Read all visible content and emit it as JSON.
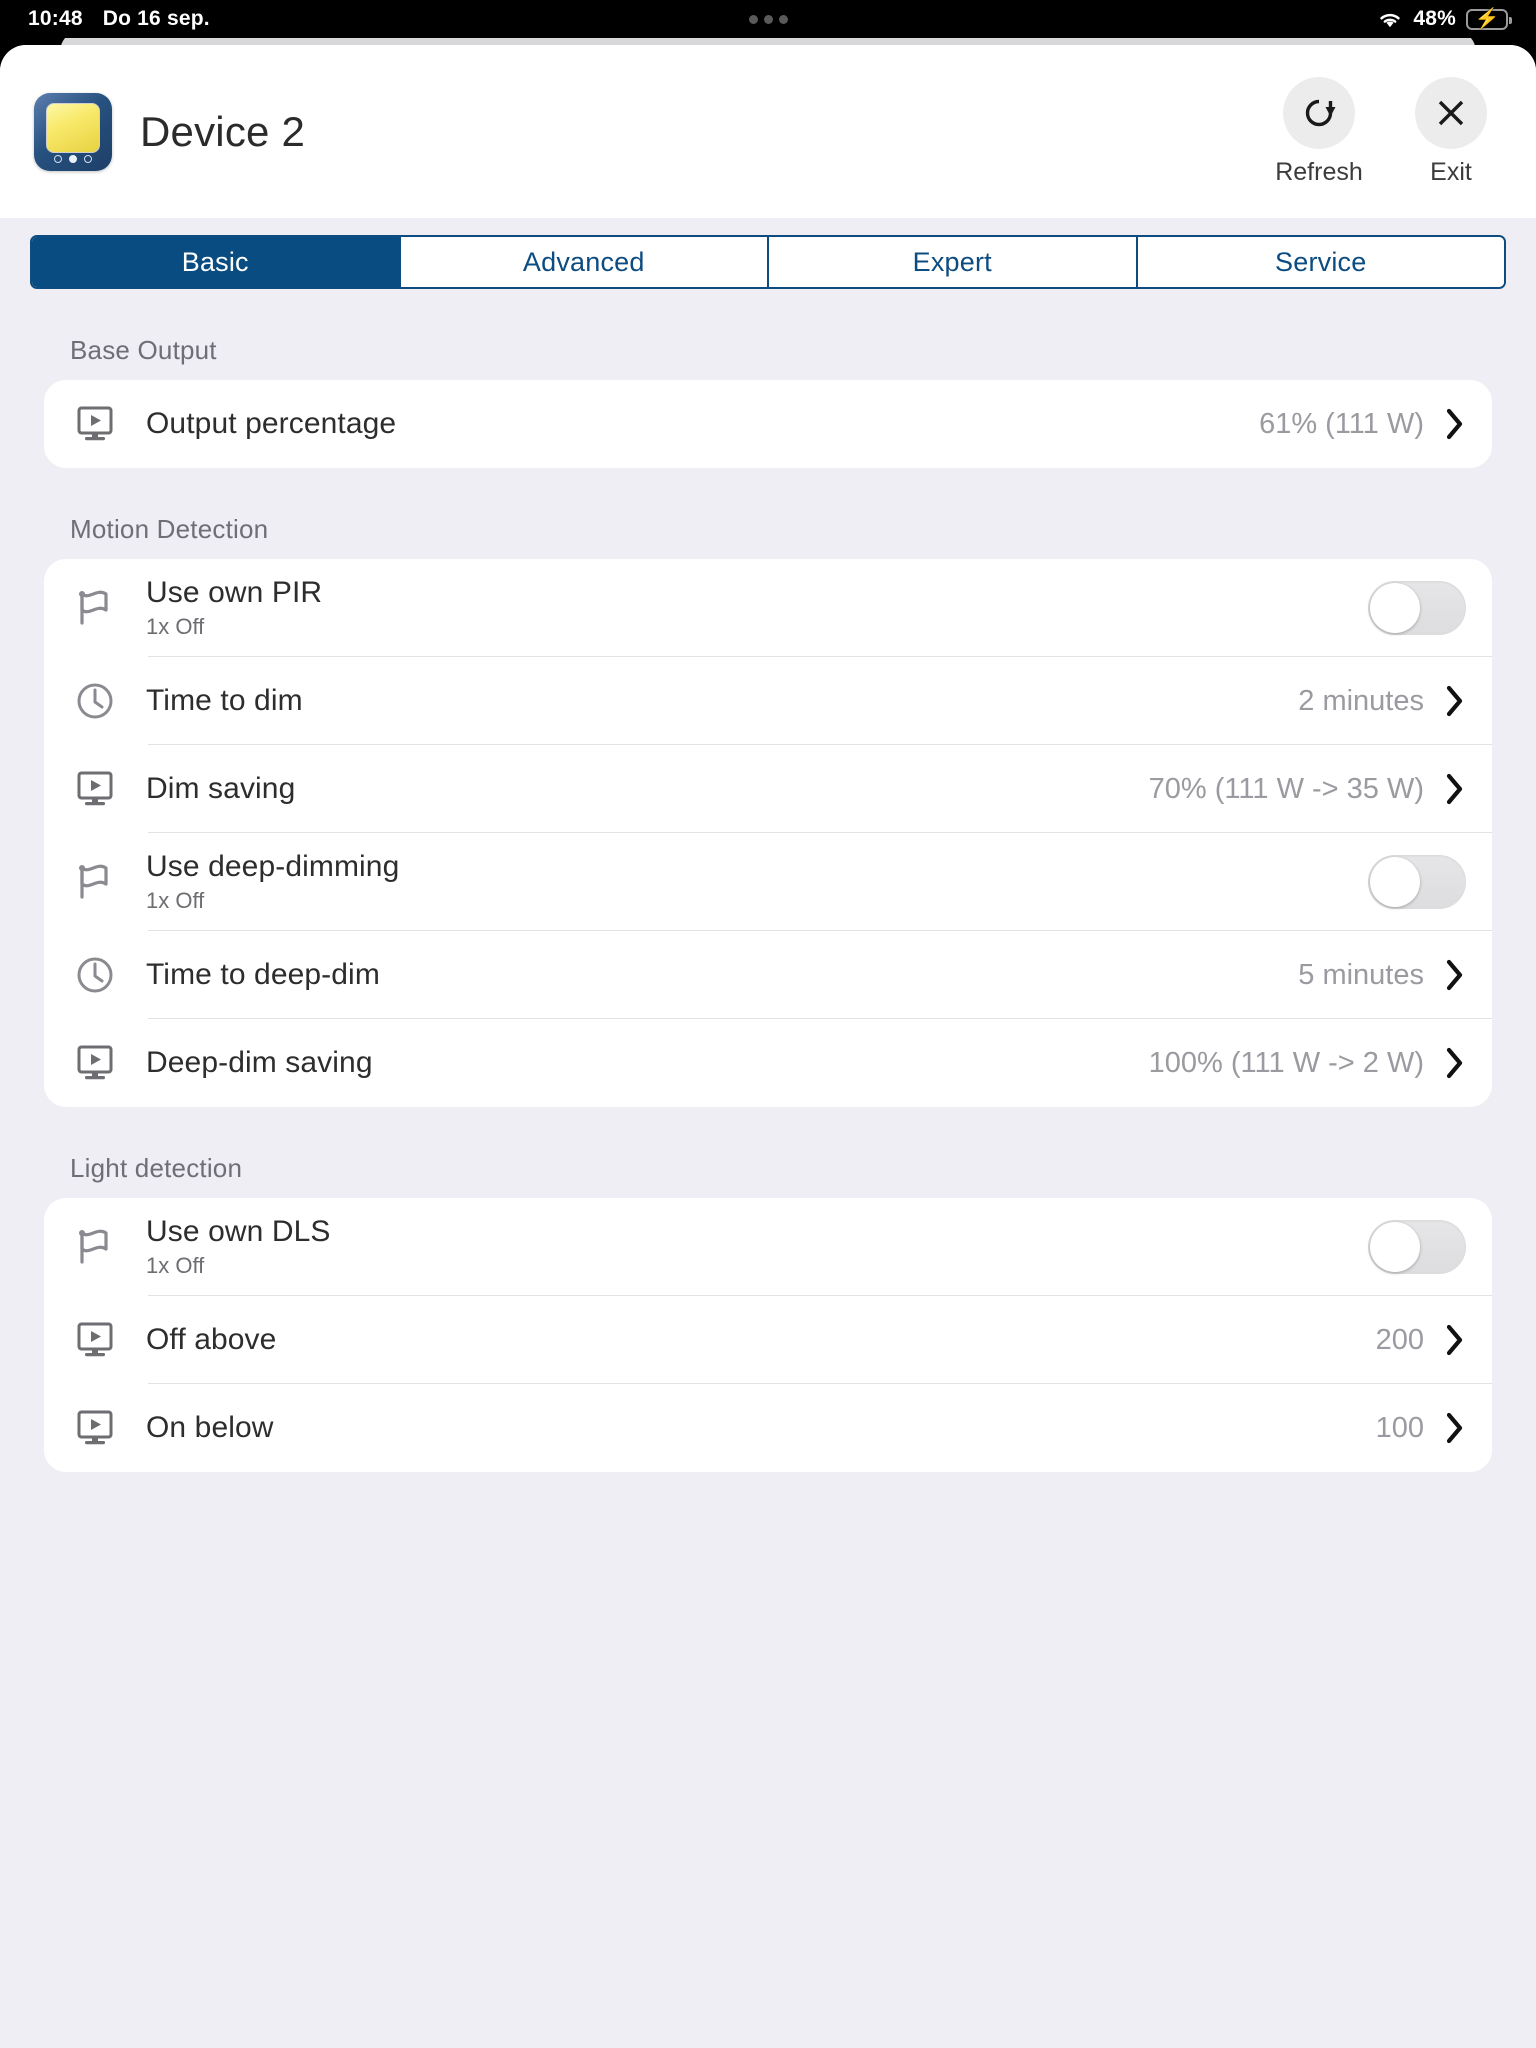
{
  "statusbar": {
    "time": "10:48",
    "date": "Do 16 sep.",
    "battery_percent": "48%",
    "wifi_icon": "wifi-icon",
    "battery_icon": "battery-charging-icon",
    "battery_fill": "#3ddc52"
  },
  "header": {
    "title": "Device 2",
    "app_icon": "device-tile-icon",
    "refresh_label": "Refresh",
    "refresh_icon": "refresh-icon",
    "exit_label": "Exit",
    "exit_icon": "close-icon"
  },
  "tabs": [
    {
      "label": "Basic",
      "active": true
    },
    {
      "label": "Advanced",
      "active": false
    },
    {
      "label": "Expert",
      "active": false
    },
    {
      "label": "Service",
      "active": false
    }
  ],
  "accent": "#084c81",
  "sections": [
    {
      "title": "Base Output",
      "rows": [
        {
          "icon": "monitor-play-icon",
          "label": "Output percentage",
          "sub": "",
          "value": "61% (111 W)",
          "control": "chevron"
        }
      ]
    },
    {
      "title": "Motion Detection",
      "rows": [
        {
          "icon": "flag-icon",
          "label": "Use own PIR",
          "sub": "1x Off",
          "value": "",
          "control": "toggle",
          "toggle_on": false
        },
        {
          "icon": "clock-icon",
          "label": "Time to dim",
          "sub": "",
          "value": "2 minutes",
          "control": "chevron"
        },
        {
          "icon": "monitor-play-icon",
          "label": "Dim saving",
          "sub": "",
          "value": "70% (111 W -> 35 W)",
          "control": "chevron"
        },
        {
          "icon": "flag-icon",
          "label": "Use deep-dimming",
          "sub": "1x Off",
          "value": "",
          "control": "toggle",
          "toggle_on": false
        },
        {
          "icon": "clock-icon",
          "label": "Time to deep-dim",
          "sub": "",
          "value": "5 minutes",
          "control": "chevron"
        },
        {
          "icon": "monitor-play-icon",
          "label": "Deep-dim saving",
          "sub": "",
          "value": "100% (111 W -> 2 W)",
          "control": "chevron"
        }
      ]
    },
    {
      "title": "Light detection",
      "rows": [
        {
          "icon": "flag-icon",
          "label": "Use own DLS",
          "sub": "1x Off",
          "value": "",
          "control": "toggle",
          "toggle_on": false
        },
        {
          "icon": "monitor-play-icon",
          "label": "Off above",
          "sub": "",
          "value": "200",
          "control": "chevron"
        },
        {
          "icon": "monitor-play-icon",
          "label": "On below",
          "sub": "",
          "value": "100",
          "control": "chevron"
        }
      ]
    }
  ]
}
